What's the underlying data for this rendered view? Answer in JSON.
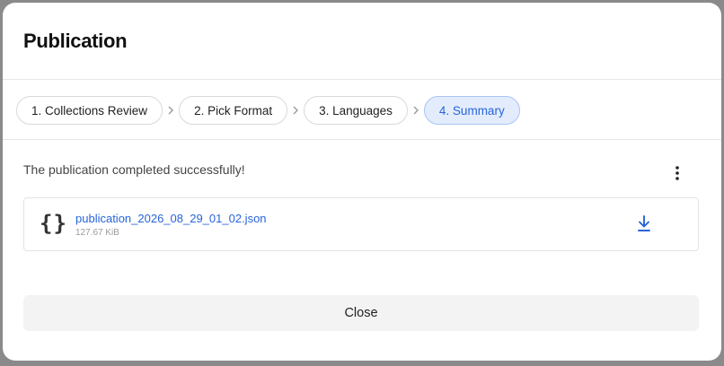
{
  "dialog": {
    "title": "Publication"
  },
  "stepper": {
    "steps": [
      {
        "label": "1. Collections Review",
        "state": "done"
      },
      {
        "label": "2. Pick Format",
        "state": "done"
      },
      {
        "label": "3. Languages",
        "state": "done"
      },
      {
        "label": "4. Summary",
        "state": "active"
      }
    ],
    "separator_icon": "chevron-right-icon"
  },
  "summary": {
    "status_message": "The publication completed successfully!",
    "menu_icon": "more-vertical-icon",
    "file": {
      "name": "publication_2026_08_29_01_02.json",
      "size": "127.67 KiB",
      "icon": "json-braces-icon",
      "icon_glyph": "{}",
      "action_icon": "download-icon"
    }
  },
  "footer": {
    "close_label": "Close"
  },
  "colors": {
    "accent": "#2764d8",
    "active_step_bg": "#e3ecfd",
    "overlay": "#8a8a8a"
  }
}
